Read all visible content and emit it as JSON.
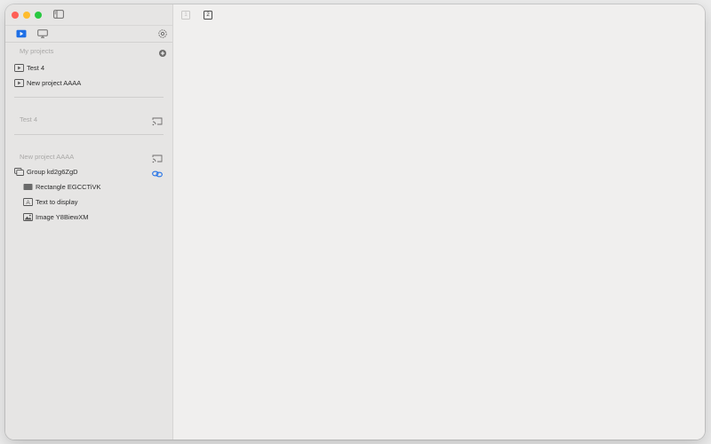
{
  "window": {
    "controls": [
      "close",
      "minimize",
      "zoom"
    ]
  },
  "sidebar": {
    "toggle_icon": "sidebar-icon",
    "tabs": [
      {
        "icon": "play-rectangle-icon",
        "selected": true
      },
      {
        "icon": "display-icon",
        "selected": false
      }
    ],
    "settings_icon": "gear-icon",
    "my_projects": {
      "header": "My projects",
      "add_icon": "plus-circle-icon",
      "items": [
        {
          "label": "Test 4",
          "icon": "play-rectangle-icon"
        },
        {
          "label": "New project AAAA",
          "icon": "play-rectangle-icon"
        }
      ]
    },
    "project_sections": [
      {
        "header": "Test 4",
        "action_icon": "cast-icon",
        "items": []
      },
      {
        "header": "New project AAAA",
        "action_icon": "cast-icon",
        "items": [
          {
            "label": "Group kd2g6ZgD",
            "icon": "group-icon",
            "link_icon": "link-icon"
          },
          {
            "label": "Rectangle EGCCTiVK",
            "icon": "rectangle-icon"
          },
          {
            "label": "Text to display",
            "icon": "text-icon"
          },
          {
            "label": "Image Y8BiewXM",
            "icon": "image-icon"
          }
        ]
      }
    ]
  },
  "content": {
    "page_buttons": [
      "1",
      "2"
    ]
  },
  "colors": {
    "accent": "#1e6fe6",
    "sidebar_bg": "#e6e5e4",
    "content_bg": "#f0efee"
  }
}
